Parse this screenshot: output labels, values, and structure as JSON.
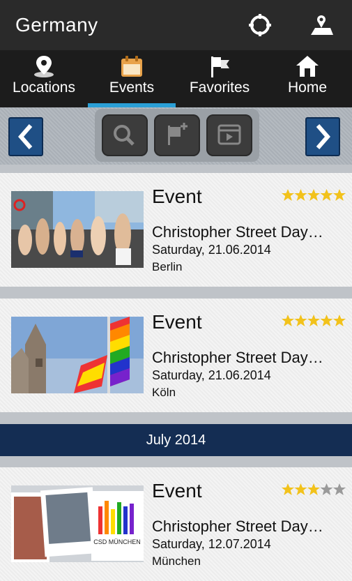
{
  "header": {
    "title": "Germany",
    "locate_icon": "crosshair-icon",
    "map_icon": "map-icon"
  },
  "nav": {
    "tabs": [
      {
        "label": "Locations",
        "icon": "pin-icon"
      },
      {
        "label": "Events",
        "icon": "calendar-icon",
        "active": true
      },
      {
        "label": "Favorites",
        "icon": "flags-icon"
      },
      {
        "label": "Home",
        "icon": "home-icon"
      }
    ]
  },
  "toolbar": {
    "prev_icon": "chevron-left-icon",
    "next_icon": "chevron-right-icon",
    "search_icon": "search-icon",
    "add_favorite_icon": "flag-add-icon",
    "calendar_icon": "calendar-play-icon"
  },
  "events": [
    {
      "type": "Event",
      "title": "Christopher Street Day…",
      "date": "Saturday, 21.06.2014",
      "city": "Berlin",
      "rating": 5
    },
    {
      "type": "Event",
      "title": "Christopher Street Day…",
      "date": "Saturday, 21.06.2014",
      "city": "Köln",
      "rating": 5
    },
    {
      "type": "Event",
      "title": "Christopher Street Day…",
      "date": "Saturday, 12.07.2014",
      "city": "München",
      "rating": 3
    }
  ],
  "month_header": "July 2014",
  "colors": {
    "accent": "#2a9fd6",
    "brand": "#1f4f85",
    "star": "#f2c21b"
  }
}
